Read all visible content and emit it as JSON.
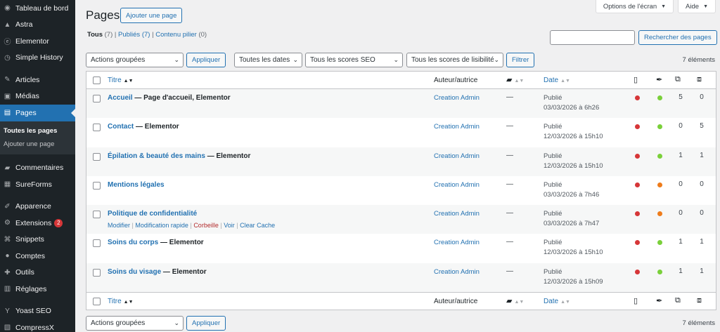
{
  "sidebar": {
    "items": [
      {
        "label": "Tableau de bord",
        "icon": "dashboard-icon"
      },
      {
        "label": "Astra",
        "icon": "astra-icon"
      },
      {
        "label": "Elementor",
        "icon": "elementor-icon"
      },
      {
        "label": "Simple History",
        "icon": "history-icon"
      },
      {
        "label": "Articles",
        "icon": "pin-icon"
      },
      {
        "label": "Médias",
        "icon": "media-icon"
      },
      {
        "label": "Pages",
        "icon": "pages-icon"
      },
      {
        "label": "Commentaires",
        "icon": "comment-icon"
      },
      {
        "label": "SureForms",
        "icon": "sureforms-icon"
      },
      {
        "label": "Apparence",
        "icon": "brush-icon"
      },
      {
        "label": "Extensions",
        "icon": "plugin-icon",
        "badge": "2"
      },
      {
        "label": "Snippets",
        "icon": "snippets-icon"
      },
      {
        "label": "Comptes",
        "icon": "users-icon"
      },
      {
        "label": "Outils",
        "icon": "wrench-icon"
      },
      {
        "label": "Réglages",
        "icon": "settings-icon"
      },
      {
        "label": "Yoast SEO",
        "icon": "yoast-icon"
      },
      {
        "label": "CompressX",
        "icon": "compressx-icon"
      }
    ],
    "submenu": [
      "Toutes les pages",
      "Ajouter une page"
    ]
  },
  "header": {
    "title": "Pages",
    "add_button": "Ajouter une page",
    "screen_options": "Options de l'écran",
    "help": "Aide"
  },
  "filters_nav": {
    "all": "Tous",
    "all_count": "(7)",
    "published": "Publiés",
    "published_count": "(7)",
    "pillar": "Contenu pilier",
    "pillar_count": "(0)",
    "sep": "|"
  },
  "search": {
    "button": "Rechercher des pages"
  },
  "toolbar": {
    "bulk": "Actions groupées",
    "apply": "Appliquer",
    "dates": "Toutes les dates",
    "seo": "Tous les scores SEO",
    "readability": "Tous les scores de lisibilité",
    "filter": "Filtrer",
    "count": "7 éléments"
  },
  "table": {
    "headers": {
      "title": "Titre",
      "author": "Auteur/autrice",
      "date": "Date"
    },
    "rows": [
      {
        "title": "Accueil",
        "state": " — Page d'accueil, Elementor",
        "author": "Creation Admin",
        "comments": "—",
        "status": "Publié",
        "date": "03/03/2026 à 6h26",
        "seo": "#d63638",
        "read": "#7ad03a",
        "in": "5",
        "out": "0"
      },
      {
        "title": "Contact",
        "state": " — Elementor",
        "author": "Creation Admin",
        "comments": "—",
        "status": "Publié",
        "date": "12/03/2026 à 15h10",
        "seo": "#d63638",
        "read": "#7ad03a",
        "in": "0",
        "out": "5"
      },
      {
        "title": "Épilation & beauté des mains",
        "state": " — Elementor",
        "author": "Creation Admin",
        "comments": "—",
        "status": "Publié",
        "date": "12/03/2026 à 15h10",
        "seo": "#d63638",
        "read": "#7ad03a",
        "in": "1",
        "out": "1"
      },
      {
        "title": "Mentions légales",
        "state": "",
        "author": "Creation Admin",
        "comments": "—",
        "status": "Publié",
        "date": "03/03/2026 à 7h46",
        "seo": "#d63638",
        "read": "#ee7c1b",
        "in": "0",
        "out": "0"
      },
      {
        "title": "Politique de confidentialité",
        "state": "",
        "author": "Creation Admin",
        "comments": "—",
        "status": "Publié",
        "date": "03/03/2026 à 7h47",
        "seo": "#d63638",
        "read": "#ee7c1b",
        "in": "0",
        "out": "0"
      },
      {
        "title": "Soins du corps",
        "state": " — Elementor",
        "author": "Creation Admin",
        "comments": "—",
        "status": "Publié",
        "date": "12/03/2026 à 15h10",
        "seo": "#d63638",
        "read": "#7ad03a",
        "in": "1",
        "out": "1"
      },
      {
        "title": "Soins du visage",
        "state": " — Elementor",
        "author": "Creation Admin",
        "comments": "—",
        "status": "Publié",
        "date": "12/03/2026 à 15h09",
        "seo": "#d63638",
        "read": "#7ad03a",
        "in": "1",
        "out": "1"
      }
    ],
    "row_actions": {
      "edit": "Modifier",
      "quick_edit": "Modification rapide",
      "trash": "Corbeille",
      "view": "Voir",
      "clear_cache": "Clear Cache",
      "sep": "|"
    }
  }
}
